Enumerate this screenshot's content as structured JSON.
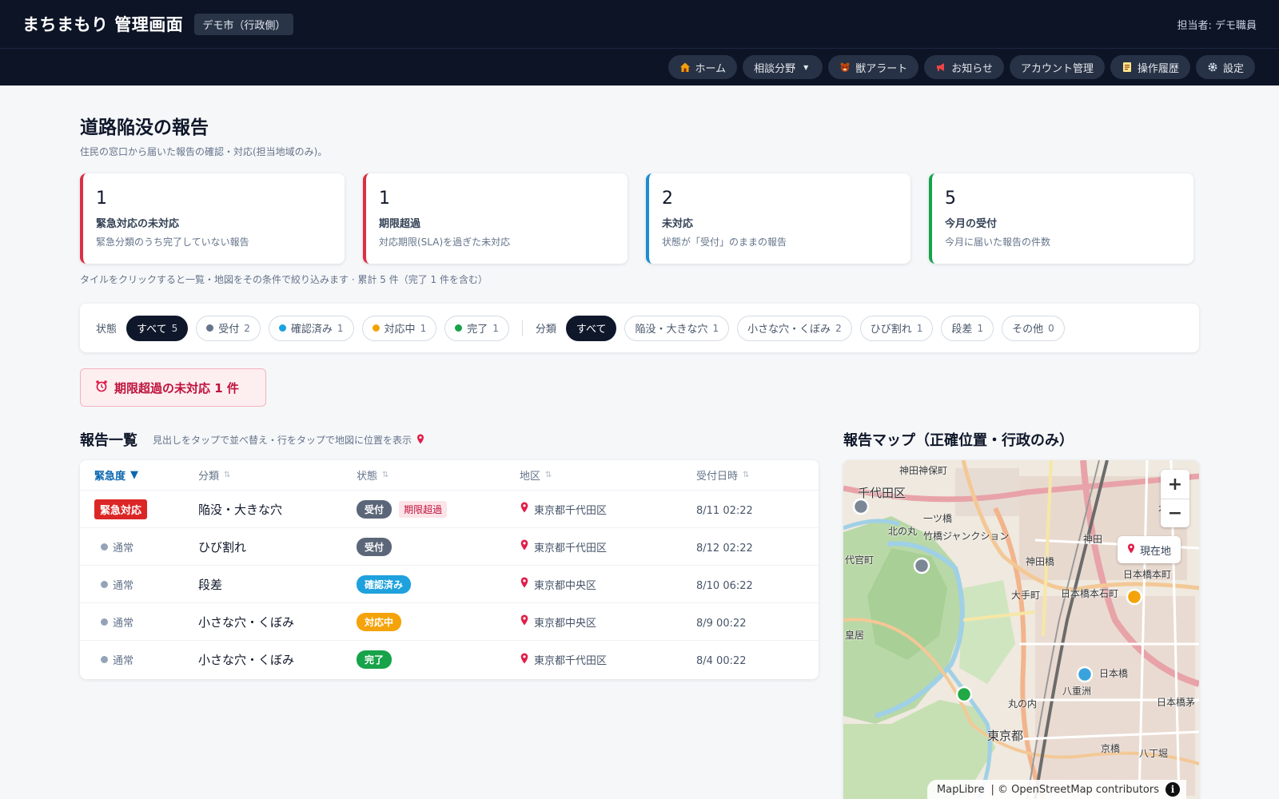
{
  "header": {
    "app_title": "まちまもり 管理画面",
    "city_badge": "デモ市（行政側）",
    "user_label": "担当者: デモ職員"
  },
  "nav": {
    "items": [
      {
        "label": "ホーム",
        "icon": "home-icon"
      },
      {
        "label": "相談分野",
        "icon": "chevron-down-icon"
      },
      {
        "label": "獣アラート",
        "icon": "bear-icon"
      },
      {
        "label": "お知らせ",
        "icon": "megaphone-icon"
      },
      {
        "label": "アカウント管理",
        "icon": ""
      },
      {
        "label": "操作履歴",
        "icon": "history-icon"
      },
      {
        "label": "設定",
        "icon": "gear-icon"
      }
    ],
    "dropdown_arrow": "▼"
  },
  "page": {
    "title": "道路陥没の報告",
    "subtitle": "住民の窓口から届いた報告の確認・対応(担当地域のみ)。"
  },
  "kpis": [
    {
      "value": "1",
      "label": "緊急対応の未対応",
      "desc": "緊急分類のうち完了していない報告",
      "color": "#dc2f45"
    },
    {
      "value": "1",
      "label": "期限超過",
      "desc": "対応期限(SLA)を過ぎた未対応",
      "color": "#dc2f45"
    },
    {
      "value": "2",
      "label": "未対応",
      "desc": "状態が「受付」のままの報告",
      "color": "#1c8ccf"
    },
    {
      "value": "5",
      "label": "今月の受付",
      "desc": "今月に届いた報告の件数",
      "color": "#16a34a"
    }
  ],
  "kpi_note": "タイルをクリックすると一覧・地図をその条件で絞り込みます · 累計 5 件（完了 1 件を含む）",
  "filters": {
    "status_label": "状態",
    "status_chips": [
      {
        "label": "すべて",
        "count": "5",
        "active": true,
        "dot": ""
      },
      {
        "label": "受付",
        "count": "2",
        "active": false,
        "dot": "#64748b"
      },
      {
        "label": "確認済み",
        "count": "1",
        "active": false,
        "dot": "#1ea1dc"
      },
      {
        "label": "対応中",
        "count": "1",
        "active": false,
        "dot": "#f5a30a"
      },
      {
        "label": "完了",
        "count": "1",
        "active": false,
        "dot": "#16a34a"
      }
    ],
    "category_label": "分類",
    "category_chips": [
      {
        "label": "すべて",
        "count": "",
        "active": true
      },
      {
        "label": "陥没・大きな穴",
        "count": "1",
        "active": false
      },
      {
        "label": "小さな穴・くぼみ",
        "count": "2",
        "active": false
      },
      {
        "label": "ひび割れ",
        "count": "1",
        "active": false
      },
      {
        "label": "段差",
        "count": "1",
        "active": false
      },
      {
        "label": "その他",
        "count": "0",
        "active": false
      }
    ]
  },
  "alert": {
    "text": "期限超過の未対応 1 件",
    "icon": "alarm-clock-icon"
  },
  "list": {
    "title": "報告一覧",
    "hint": "見出しをタップで並べ替え・行をタップで地図に位置を表示",
    "columns": [
      "緊急度",
      "分類",
      "状態",
      "地区",
      "受付日時"
    ],
    "sorted_marker": "▼",
    "unsorted_marker": "⇅",
    "rows": [
      {
        "urgency": "緊急対応",
        "urgent": true,
        "category": "陥没・大きな穴",
        "status": "受付",
        "status_color": "#5b6678",
        "overdue": "期限超過",
        "area": "東京都千代田区",
        "date": "8/11 02:22"
      },
      {
        "urgency": "通常",
        "urgent": false,
        "category": "ひび割れ",
        "status": "受付",
        "status_color": "#5b6678",
        "overdue": "",
        "area": "東京都千代田区",
        "date": "8/12 02:22"
      },
      {
        "urgency": "通常",
        "urgent": false,
        "category": "段差",
        "status": "確認済み",
        "status_color": "#1ea1dc",
        "overdue": "",
        "area": "東京都中央区",
        "date": "8/10 06:22"
      },
      {
        "urgency": "通常",
        "urgent": false,
        "category": "小さな穴・くぼみ",
        "status": "対応中",
        "status_color": "#f5a30a",
        "overdue": "",
        "area": "東京都中央区",
        "date": "8/9 00:22"
      },
      {
        "urgency": "通常",
        "urgent": false,
        "category": "小さな穴・くぼみ",
        "status": "完了",
        "status_color": "#16a34a",
        "overdue": "",
        "area": "東京都千代田区",
        "date": "8/4 00:22"
      }
    ]
  },
  "map": {
    "title": "報告マップ（正確位置・行政のみ）",
    "zoom_in": "+",
    "zoom_out": "−",
    "locate_label": "現在地",
    "attribution_maplibre": "MapLibre",
    "attribution_osm": "| © OpenStreetMap contributors",
    "info": "i",
    "labels": [
      "神田神保町",
      "千代田区",
      "北の丸",
      "一ツ橋",
      "竹橋ジャンクション",
      "代官町",
      "神田",
      "本町",
      "神田橋",
      "日本橋本町",
      "大手町",
      "日本橋本石町",
      "皇居",
      "日本橋",
      "八重洲",
      "丸の内",
      "東京都",
      "日本橋茅",
      "京橋",
      "八丁堀"
    ]
  }
}
